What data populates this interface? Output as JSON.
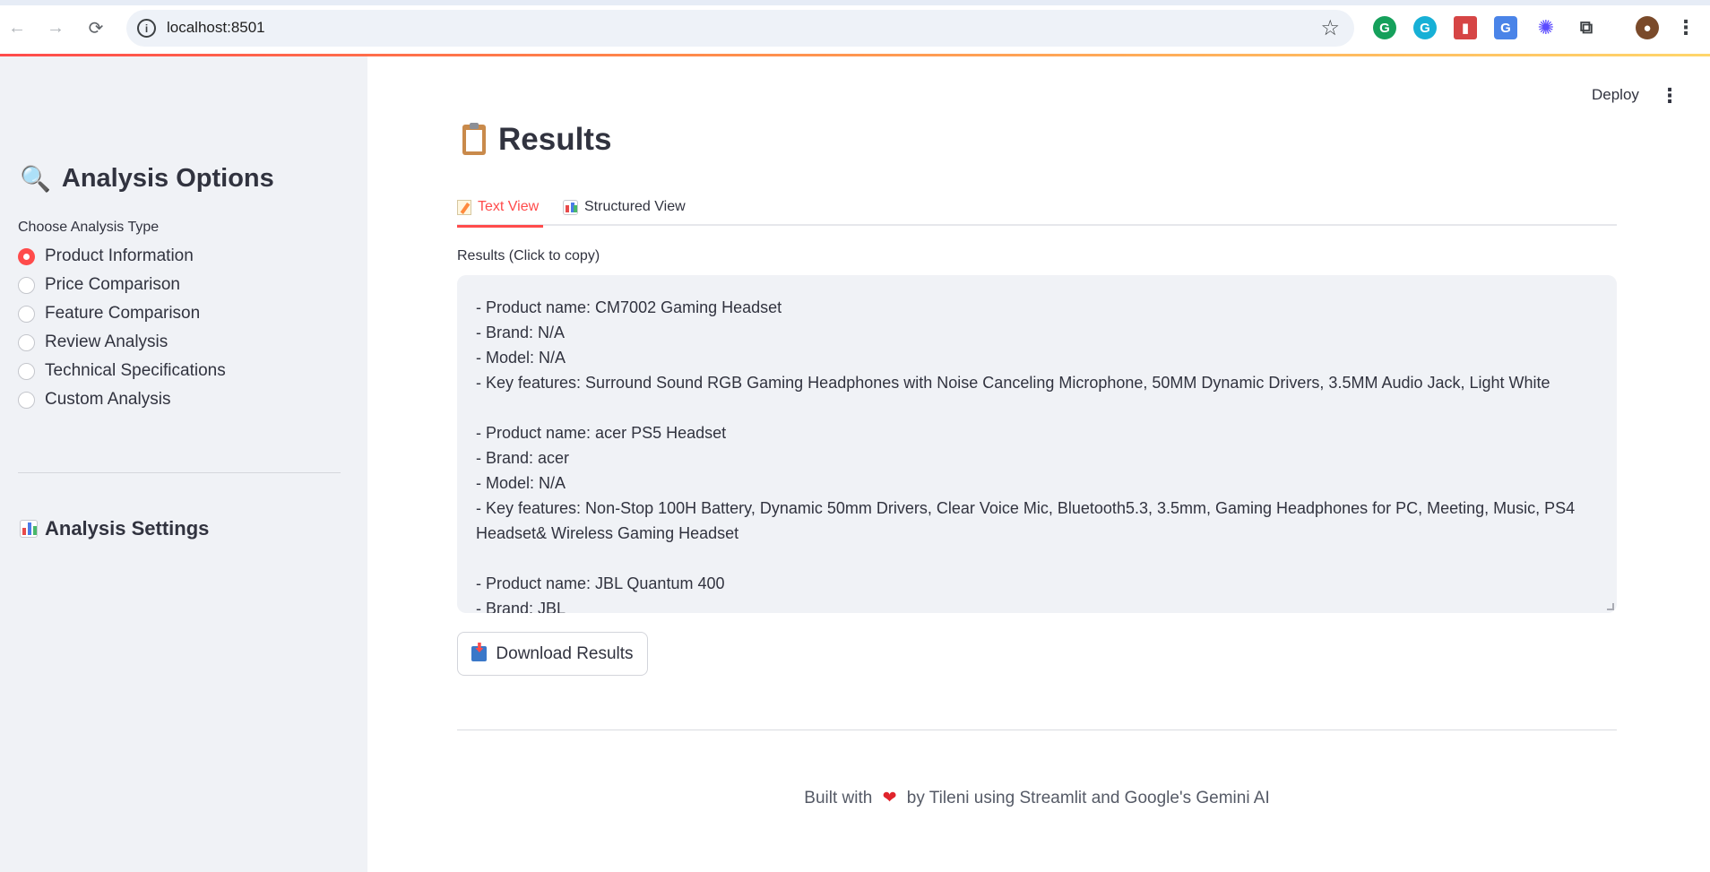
{
  "browser": {
    "url": "localhost:8501"
  },
  "sidebar": {
    "title": "Analysis Options",
    "title_emoji": "🔍",
    "choose_label": "Choose Analysis Type",
    "options": [
      {
        "label": "Product Information",
        "selected": true
      },
      {
        "label": "Price Comparison",
        "selected": false
      },
      {
        "label": "Feature Comparison",
        "selected": false
      },
      {
        "label": "Review Analysis",
        "selected": false
      },
      {
        "label": "Technical Specifications",
        "selected": false
      },
      {
        "label": "Custom Analysis",
        "selected": false
      }
    ],
    "settings_title": "Analysis Settings"
  },
  "header": {
    "deploy_label": "Deploy",
    "menu_icon": "⋮"
  },
  "main": {
    "title": "Results",
    "tabs": [
      {
        "label": "Text View",
        "active": true
      },
      {
        "label": "Structured View",
        "active": false
      }
    ],
    "results_label": "Results (Click to copy)",
    "results_lines": [
      "- Product name: CM7002 Gaming Headset",
      "- Brand: N/A",
      "- Model: N/A",
      "- Key features: Surround Sound RGB Gaming Headphones with Noise Canceling Microphone, 50MM Dynamic Drivers, 3.5MM Audio Jack, Light White",
      "",
      "- Product name: acer PS5 Headset",
      "- Brand: acer",
      "- Model: N/A",
      "- Key features: Non-Stop 100H Battery, Dynamic 50mm Drivers, Clear Voice Mic, Bluetooth5.3, 3.5mm, Gaming Headphones for PC, Meeting, Music, PS4 Headset& Wireless Gaming Headset",
      "",
      "- Product name: JBL Quantum 400",
      "- Brand: JBL"
    ],
    "download_label": "Download Results"
  },
  "footer": {
    "before": "Built with",
    "heart": "❤",
    "after": "by Tileni using Streamlit and Google's Gemini AI"
  },
  "colors": {
    "accent": "#ff4b4b",
    "sidebar_bg": "#f0f2f6",
    "text": "#31333f"
  }
}
